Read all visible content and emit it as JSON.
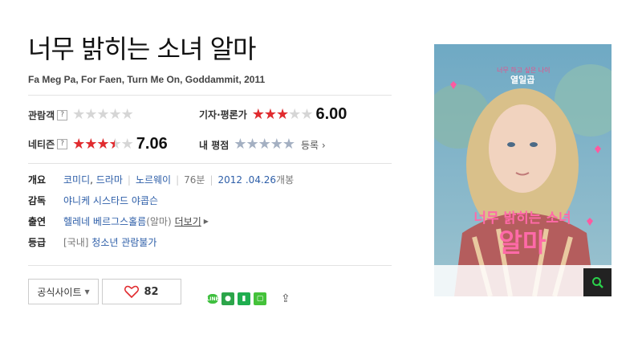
{
  "title": "너무 밝히는 소녀 알마",
  "subtitle": "Fa Meg Pa, For Faen, Turn Me On, Goddammit, 2011",
  "ratings": {
    "audience": {
      "label": "관람객",
      "help": "?",
      "stars": 0
    },
    "critic": {
      "label": "기자·평론가",
      "stars": 3.0,
      "score": "6.00"
    },
    "netizen": {
      "label": "네티즌",
      "help": "?",
      "stars": 3.5,
      "score": "7.06"
    },
    "my": {
      "label": "내 평점",
      "stars": 0,
      "register": "등록 ›"
    }
  },
  "info": {
    "overview_label": "개요",
    "genres": [
      "코미디",
      "드라마"
    ],
    "country": "노르웨이",
    "runtime": "76분",
    "release_date": "2012 .04.26",
    "release_suffix": "개봉",
    "director_label": "감독",
    "director": "야니케 시스타드 야콥슨",
    "cast_label": "출연",
    "cast": "헬레네 베르그스홀름",
    "cast_role": "(알마)",
    "more": "더보기",
    "grade_label": "등급",
    "grade_prefix": "[국내]",
    "grade": "청소년 관람불가"
  },
  "buttons": {
    "official_site": "공식사이트",
    "like_count": "82"
  },
  "share_icons": [
    "line-icon",
    "kakao-icon",
    "bookmark-icon",
    "band-icon",
    "share-icon"
  ],
  "poster": {
    "title_text": "너무 밝히는 소녀",
    "title_big": "알마",
    "tagline_top": "너무 하고 싶은 나이",
    "tagline_tag": "열일곱"
  },
  "colors": {
    "accent_red": "#e12b2f",
    "link_blue": "#2d5ea8"
  }
}
